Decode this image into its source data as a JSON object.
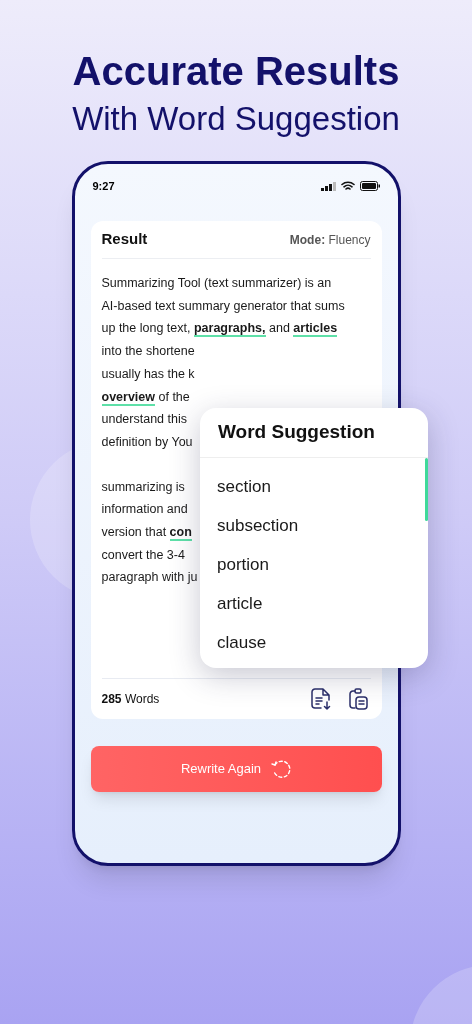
{
  "headline": {
    "title": "Accurate Results",
    "subtitle": "With Word Suggestion"
  },
  "status_bar": {
    "time": "9:27"
  },
  "result_card": {
    "title": "Result",
    "mode_label": "Mode:",
    "mode_value": "Fluency",
    "paragraphs": [
      [
        [
          {
            "text": "Summarizing Tool (text summarizer) is an",
            "highlighted": false
          }
        ],
        [
          {
            "text": "AI-based text summary generator that sums",
            "highlighted": false
          }
        ],
        [
          {
            "text": "up the long text, ",
            "highlighted": false
          },
          {
            "text": "paragraphs,",
            "highlighted": true
          },
          {
            "text": " and ",
            "highlighted": false
          },
          {
            "text": "articles",
            "highlighted": true
          }
        ],
        [
          {
            "text": "into the shortene",
            "highlighted": false
          }
        ],
        [
          {
            "text": "usually has the k",
            "highlighted": false
          }
        ],
        [
          {
            "text": "overview",
            "highlighted": true
          },
          {
            "text": " of the",
            "highlighted": false
          }
        ],
        [
          {
            "text": "understand this",
            "highlighted": false
          }
        ],
        [
          {
            "text": "definition by You",
            "highlighted": false
          }
        ]
      ],
      [
        [
          {
            "text": "summarizing is",
            "highlighted": false
          }
        ],
        [
          {
            "text": "information and",
            "highlighted": false
          }
        ],
        [
          {
            "text": "version that ",
            "highlighted": false
          },
          {
            "text": "con",
            "highlighted": true
          }
        ],
        [
          {
            "text": "convert the 3-4",
            "highlighted": false
          }
        ],
        [
          {
            "text": "paragraph with ju",
            "highlighted": false
          }
        ]
      ]
    ],
    "word_count": "285",
    "word_label": "Words"
  },
  "suggestion_popup": {
    "title": "Word Suggestion",
    "items": [
      "section",
      "subsection",
      "portion",
      "article",
      "clause"
    ]
  },
  "rewrite_button": {
    "label": "Rewrite Again"
  }
}
